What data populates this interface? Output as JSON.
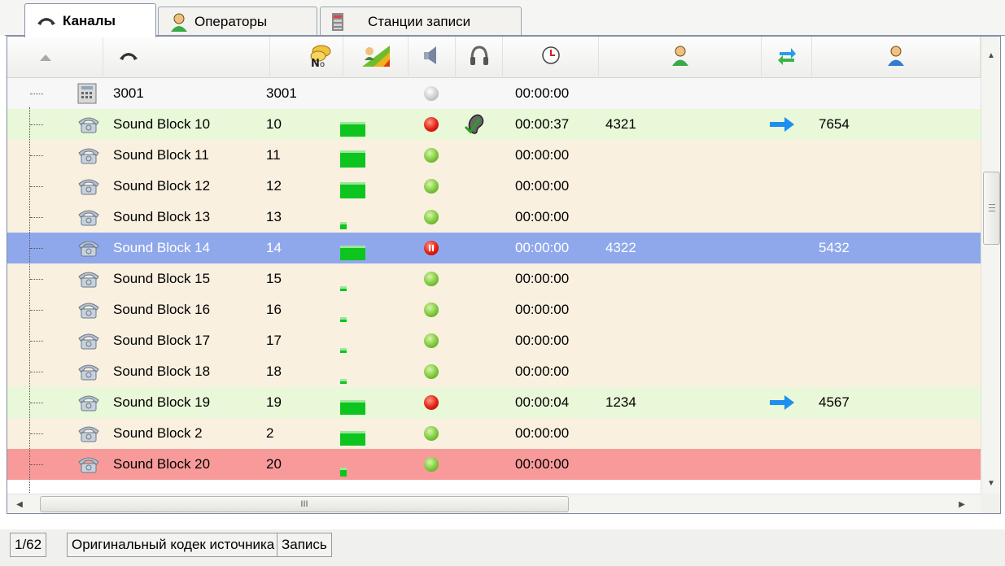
{
  "tabs": [
    {
      "label": "Каналы",
      "icon": "phone-handset-icon",
      "active": true
    },
    {
      "label": "Операторы",
      "icon": "operator-person-icon",
      "active": false
    },
    {
      "label": "Станции записи",
      "icon": "recording-station-icon",
      "active": false
    }
  ],
  "header": {
    "columns": [
      {
        "name": "sort-indicator",
        "icon": "sort-up-arrow-icon"
      },
      {
        "name": "channel",
        "icon": "phone-handset-icon"
      },
      {
        "name": "number",
        "icon": "number-sign-icon"
      },
      {
        "name": "level",
        "icon": "signal-level-icon"
      },
      {
        "name": "speaker",
        "icon": "speaker-icon"
      },
      {
        "name": "headphones",
        "icon": "headphones-icon"
      },
      {
        "name": "duration",
        "icon": "clock-icon"
      },
      {
        "name": "caller",
        "icon": "caller-person-icon"
      },
      {
        "name": "direction",
        "icon": "transfer-arrows-icon"
      },
      {
        "name": "callee",
        "icon": "callee-person-icon"
      }
    ]
  },
  "rows": [
    {
      "icon": "pbx-device-icon",
      "name": "3001",
      "num": "3001",
      "level": 0,
      "status": "grey",
      "listen": false,
      "time": "00:00:00",
      "caller": "",
      "arrow": false,
      "callee": "",
      "style": "white"
    },
    {
      "icon": "telephone-icon",
      "name": "Sound Block 10",
      "num": "10",
      "level": 0.6,
      "status": "red",
      "listen": true,
      "time": "00:00:37",
      "caller": "4321",
      "arrow": true,
      "callee": "7654",
      "style": "green"
    },
    {
      "icon": "telephone-icon",
      "name": "Sound Block 11",
      "num": "11",
      "level": 0.7,
      "status": "green",
      "listen": false,
      "time": "00:00:00",
      "caller": "",
      "arrow": false,
      "callee": "",
      "style": "cream"
    },
    {
      "icon": "telephone-icon",
      "name": "Sound Block 12",
      "num": "12",
      "level": 0.65,
      "status": "green",
      "listen": false,
      "time": "00:00:00",
      "caller": "",
      "arrow": false,
      "callee": "",
      "style": "cream"
    },
    {
      "icon": "telephone-icon",
      "name": "Sound Block 13",
      "num": "13",
      "level": 0.3,
      "status": "green",
      "listen": false,
      "time": "00:00:00",
      "caller": "",
      "arrow": false,
      "callee": "",
      "style": "cream"
    },
    {
      "icon": "telephone-icon",
      "name": "Sound Block 14",
      "num": "14",
      "level": 0.6,
      "status": "pause",
      "listen": false,
      "time": "00:00:00",
      "caller": "4322",
      "arrow": false,
      "callee": "5432",
      "style": "blue"
    },
    {
      "icon": "telephone-icon",
      "name": "Sound Block 15",
      "num": "15",
      "level": 0.2,
      "status": "green",
      "listen": false,
      "time": "00:00:00",
      "caller": "",
      "arrow": false,
      "callee": "",
      "style": "cream"
    },
    {
      "icon": "telephone-icon",
      "name": "Sound Block 16",
      "num": "16",
      "level": 0.2,
      "status": "green",
      "listen": false,
      "time": "00:00:00",
      "caller": "",
      "arrow": false,
      "callee": "",
      "style": "cream"
    },
    {
      "icon": "telephone-icon",
      "name": "Sound Block 17",
      "num": "17",
      "level": 0.2,
      "status": "green",
      "listen": false,
      "time": "00:00:00",
      "caller": "",
      "arrow": false,
      "callee": "",
      "style": "cream"
    },
    {
      "icon": "telephone-icon",
      "name": "Sound Block 18",
      "num": "18",
      "level": 0.2,
      "status": "green",
      "listen": false,
      "time": "00:00:00",
      "caller": "",
      "arrow": false,
      "callee": "",
      "style": "cream"
    },
    {
      "icon": "telephone-icon",
      "name": "Sound Block 19",
      "num": "19",
      "level": 0.6,
      "status": "red",
      "listen": false,
      "time": "00:00:04",
      "caller": "1234",
      "arrow": true,
      "callee": "4567",
      "style": "green"
    },
    {
      "icon": "telephone-icon",
      "name": "Sound Block 2",
      "num": "2",
      "level": 0.6,
      "status": "green",
      "listen": false,
      "time": "00:00:00",
      "caller": "",
      "arrow": false,
      "callee": "",
      "style": "cream"
    },
    {
      "icon": "telephone-icon",
      "name": "Sound Block 20",
      "num": "20",
      "level": 0.35,
      "status": "green",
      "listen": false,
      "time": "00:00:00",
      "caller": "",
      "arrow": false,
      "callee": "",
      "style": "red"
    }
  ],
  "scrollbar": {
    "grip": "III"
  },
  "status": {
    "count": "1/62",
    "codec": "Оригинальный кодек источника",
    "mode": "Запись"
  },
  "colors": {
    "row_white": "#f7f7f7",
    "row_cream": "#f9f0e0",
    "row_green": "#e8f8d8",
    "row_selected": "#8fa8ec",
    "row_red": "#f99a9a",
    "level_green": "#0ec41e",
    "arrow_blue": "#1e8ff0"
  }
}
